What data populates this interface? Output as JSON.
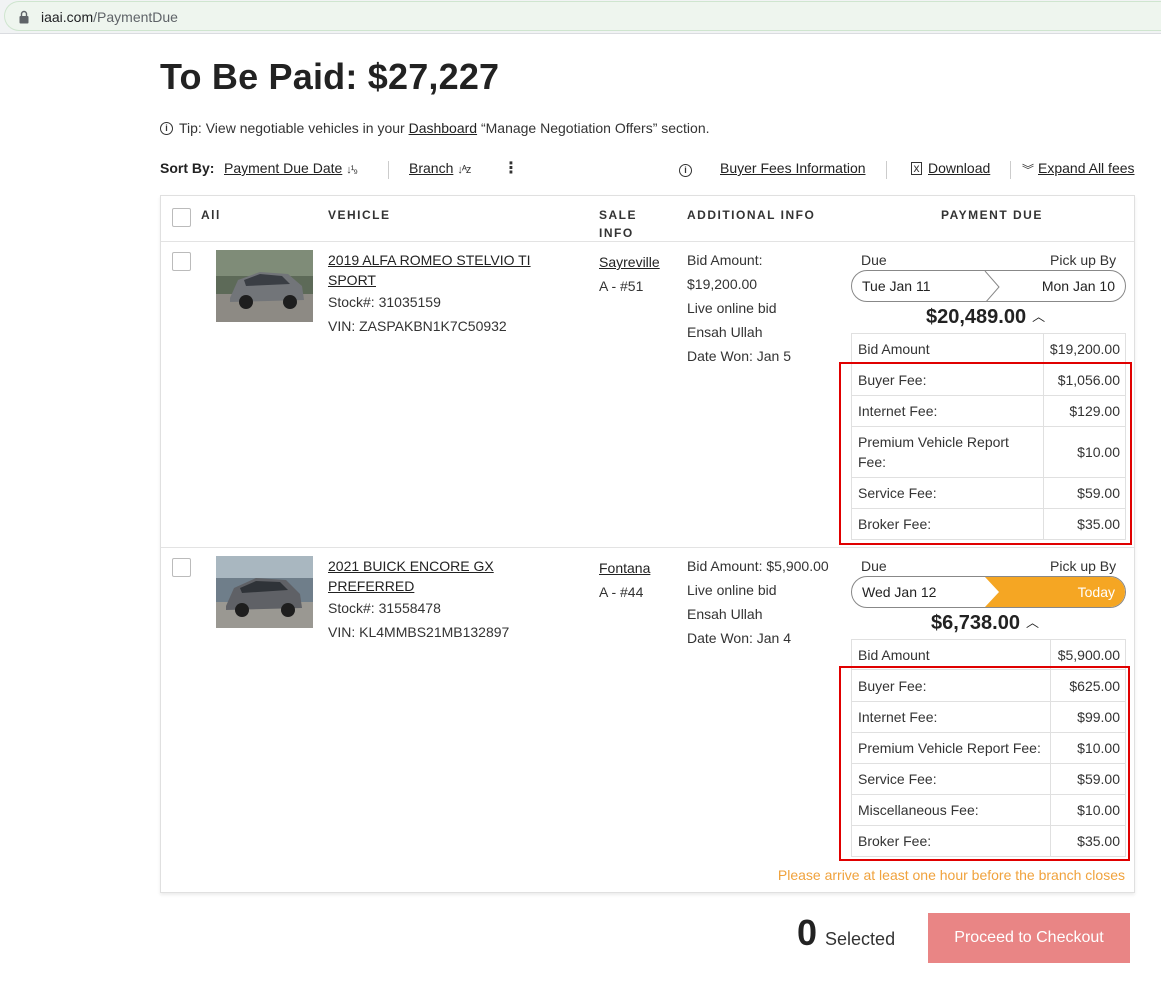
{
  "browser": {
    "url_host": "iaai.com",
    "url_path": "/PaymentDue"
  },
  "page": {
    "title": "To Be Paid: $27,227"
  },
  "tip": {
    "prefix": "Tip: View negotiable vehicles in your ",
    "link": "Dashboard",
    "suffix": " “Manage Negotiation Offers” section."
  },
  "sort": {
    "label": "Sort By:",
    "option1": "Payment Due Date",
    "option1_icon": "↓1 9",
    "option2": "Branch",
    "option2_icon": "↓A Z",
    "buyer_fees": "Buyer Fees Information",
    "download": "Download",
    "expand": "Expand All fees"
  },
  "table": {
    "headers": {
      "all": "All",
      "vehicle": "VEHICLE",
      "sale_info_1": "SALE",
      "sale_info_2": "INFO",
      "additional": "ADDITIONAL INFO",
      "payment": "PAYMENT DUE"
    },
    "rows": [
      {
        "title_l1": "2019 ALFA ROMEO STELVIO TI",
        "title_l2": "SPORT",
        "stock": "Stock#: 31035159",
        "vin": "VIN: ZASPAKBN1K7C50932",
        "branch": "Sayreville",
        "lane": "A - #51",
        "addl": [
          "Bid Amount:",
          "$19,200.00",
          "Live online bid",
          "Ensah Ullah",
          "Date Won: Jan 5"
        ],
        "due_label": "Due",
        "pickup_label": "Pick up By",
        "due_date": "Tue Jan 11",
        "pickup_date": "Mon Jan 10",
        "total": "$20,489.00",
        "fees": [
          {
            "label": "Bid Amount",
            "amount": "$19,200.00"
          },
          {
            "label": "Buyer Fee:",
            "amount": "$1,056.00"
          },
          {
            "label": "Internet Fee:",
            "amount": "$129.00"
          },
          {
            "label": "Premium Vehicle Report Fee:",
            "amount": "$10.00"
          },
          {
            "label": "Service Fee:",
            "amount": "$59.00"
          },
          {
            "label": "Broker Fee:",
            "amount": "$35.00"
          }
        ]
      },
      {
        "title_l1": "2021 BUICK ENCORE GX",
        "title_l2": "PREFERRED",
        "stock": "Stock#: 31558478",
        "vin": "VIN: KL4MMBS21MB132897",
        "branch": "Fontana",
        "lane": "A - #44",
        "addl": [
          "Bid Amount: $5,900.00",
          "Live online bid",
          "Ensah Ullah",
          "Date Won: Jan 4"
        ],
        "due_label": "Due",
        "pickup_label": "Pick up By",
        "due_date": "Wed Jan 12",
        "pickup_date": "Today",
        "total": "$6,738.00",
        "fees": [
          {
            "label": "Bid Amount",
            "amount": "$5,900.00"
          },
          {
            "label": "Buyer Fee:",
            "amount": "$625.00"
          },
          {
            "label": "Internet Fee:",
            "amount": "$99.00"
          },
          {
            "label": "Premium Vehicle Report Fee:",
            "amount": "$10.00"
          },
          {
            "label": "Service Fee:",
            "amount": "$59.00"
          },
          {
            "label": "Miscellaneous Fee:",
            "amount": "$10.00"
          },
          {
            "label": "Broker Fee:",
            "amount": "$35.00"
          }
        ]
      }
    ],
    "warning": "Please arrive at least one hour before the branch closes"
  },
  "footer": {
    "selected_count": "0",
    "selected_label": "Selected",
    "checkout": "Proceed to Checkout"
  },
  "colors": {
    "accent_orange": "#f5a623",
    "checkout_bg": "#e98585",
    "highlight_red": "#e00000"
  }
}
